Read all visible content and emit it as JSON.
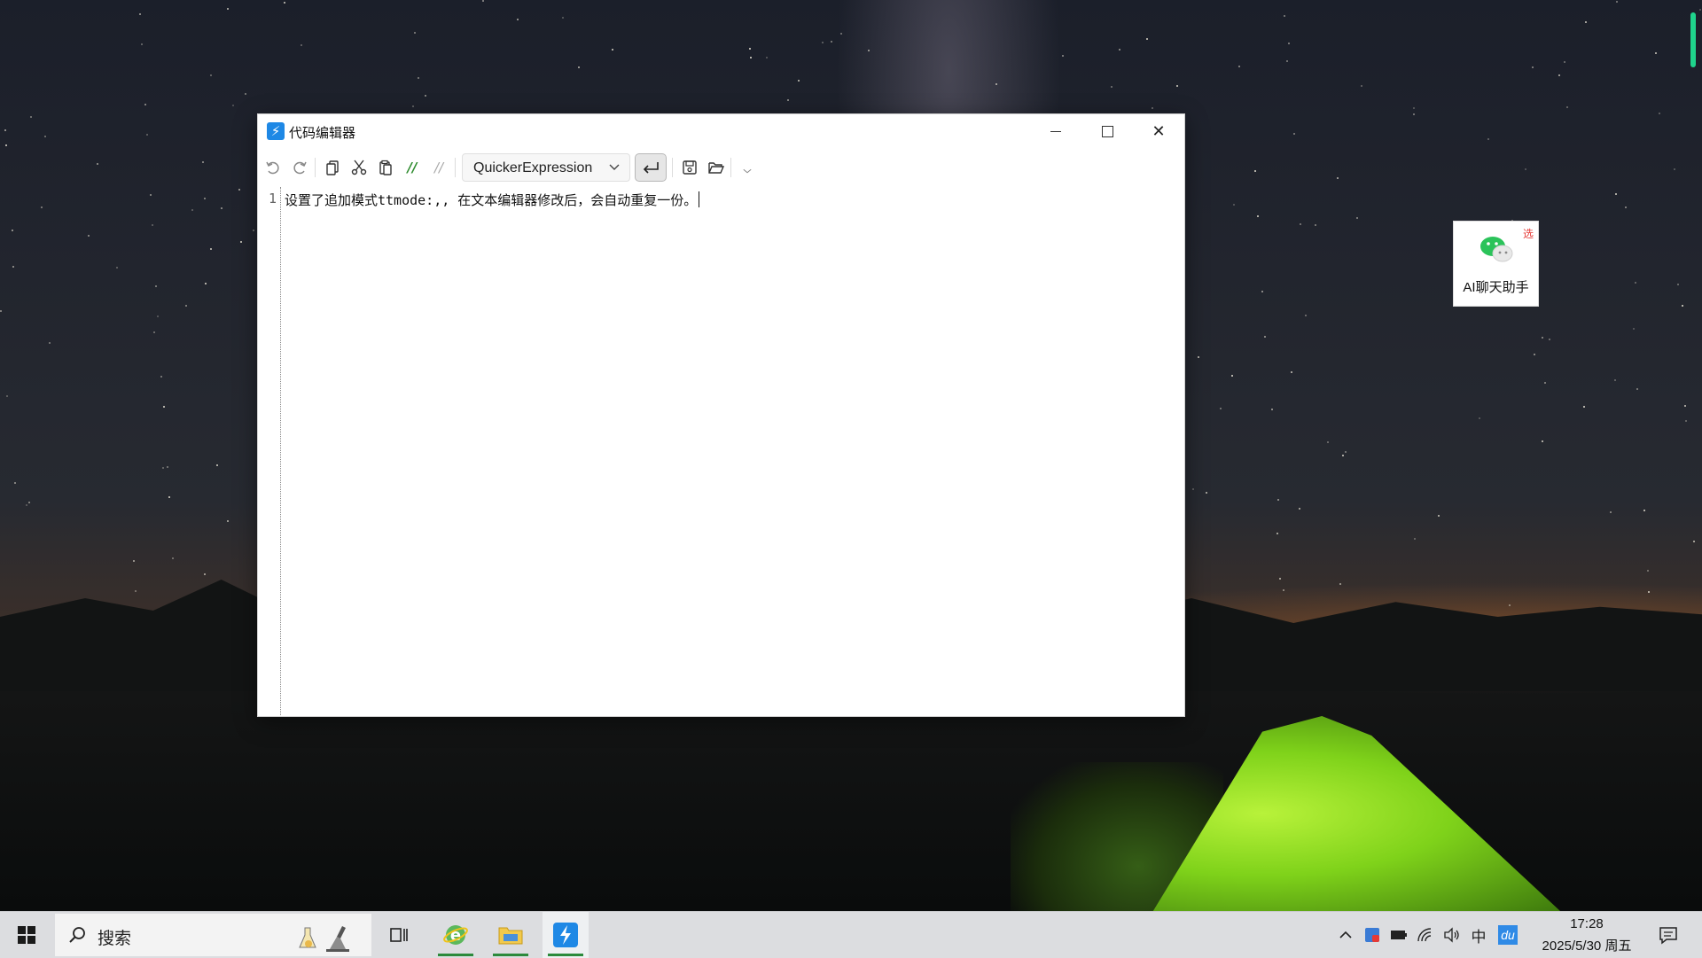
{
  "window": {
    "title": "代码编辑器",
    "app_icon": "quicker-lightning-icon",
    "controls": [
      "minimize",
      "maximize",
      "close"
    ]
  },
  "toolbar": {
    "buttons": [
      "undo",
      "redo",
      "copy",
      "cut",
      "paste",
      "comment",
      "uncomment",
      "word-wrap",
      "save",
      "open-folder",
      "more"
    ],
    "comment_label": "//",
    "uncomment_label": "//",
    "language_select": {
      "value": "QuickerExpression"
    }
  },
  "editor": {
    "lines": [
      {
        "number": "1",
        "text": "设置了追加模式ttmode:,, 在文本编辑器修改后，会自动重复一份。"
      }
    ]
  },
  "floating_widget": {
    "label": "AI聊天助手",
    "badge": "选",
    "icon": "wechat-icon"
  },
  "taskbar": {
    "search_label": "搜索",
    "apps": [
      "task-view",
      "internet-explorer",
      "file-explorer",
      "quicker"
    ],
    "tray": {
      "icons": [
        "chevron-up",
        "security-badge",
        "battery",
        "wifi",
        "volume",
        "input-method",
        "baidu-input"
      ],
      "input_method_label": "中",
      "baidu_label": "du"
    },
    "clock": {
      "time": "17:28",
      "date": "2025/5/30 周五"
    }
  },
  "colors": {
    "tent_green": "#9be02a",
    "accent_blue": "#1e88e5",
    "comment_green": "#2e8b2e",
    "indicator_green": "#1fd38c"
  }
}
